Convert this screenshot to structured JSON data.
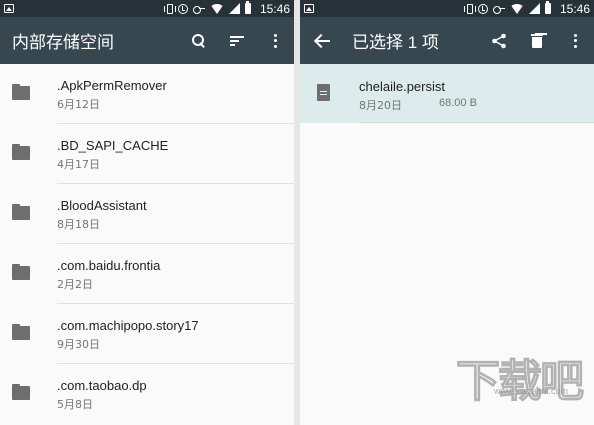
{
  "status_bar": {
    "time": "15:46"
  },
  "left_panel": {
    "title": "内部存储空间",
    "actions": [
      "search-icon",
      "sort-icon",
      "more-icon"
    ],
    "folders": [
      {
        "name": ".ApkPermRemover",
        "date": "6月12日"
      },
      {
        "name": ".BD_SAPI_CACHE",
        "date": "4月17日"
      },
      {
        "name": ".BloodAssistant",
        "date": "8月18日"
      },
      {
        "name": ".com.baidu.frontia",
        "date": "2月2日"
      },
      {
        "name": ".com.machipopo.story17",
        "date": "9月30日"
      },
      {
        "name": ".com.taobao.dp",
        "date": "5月8日"
      }
    ]
  },
  "right_panel": {
    "title": "已选择 1 项",
    "actions": [
      "back-icon",
      "share-icon",
      "delete-icon",
      "more-icon"
    ],
    "selected_file": {
      "name": "chelaile.persist",
      "date": "8月20日",
      "size": "68.00 B"
    }
  },
  "watermark": {
    "logo": "下载吧",
    "url": "www.xiazaiba.com"
  },
  "colors": {
    "status_bar": "#263238",
    "toolbar": "#37474f",
    "background": "#fafafa",
    "selected_row": "#dcecec",
    "icon_gray": "#6e6e6e"
  }
}
